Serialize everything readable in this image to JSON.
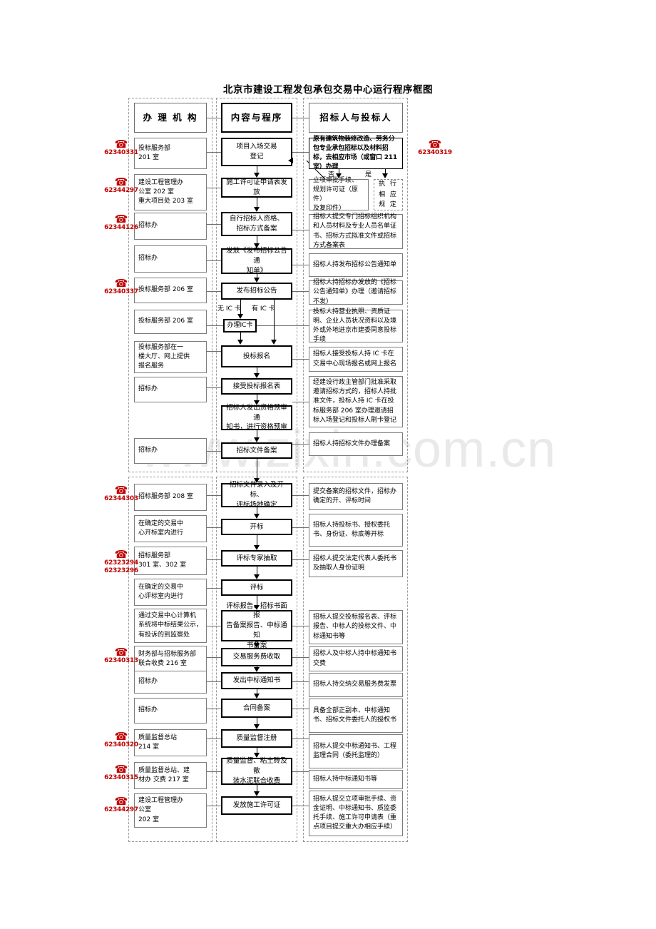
{
  "title": "北京市建设工程发包承包交易中心运行程序框图",
  "watermark": "www.zixin.com.cn",
  "headers": {
    "left": "办 理 机 构",
    "center": "内容与程序",
    "right": "招标人与投标人"
  },
  "branch_labels": {
    "no": "否",
    "yes": "是",
    "no_ic": "无 IC 卡",
    "has_ic": "有 IC 卡"
  },
  "left_column": [
    {
      "text": "投标服务部\n201 室"
    },
    {
      "text": "建设工程管理办\n公室 202 室\n重大项目处 203 室"
    },
    {
      "text": "招标办"
    },
    {
      "text": "招标办"
    },
    {
      "text": "投标服务部 206 室"
    },
    {
      "text": "投标服务部 206 室"
    },
    {
      "text": "投标服务部在一\n楼大厅、网上提供\n报名服务"
    },
    {
      "text": "招标办"
    },
    {
      "text": "招标办"
    },
    {
      "text": "招标服务部 208 室"
    },
    {
      "text": "在确定的交易中\n心开标室内进行"
    },
    {
      "text": "招标服务部\n301 室、302 室"
    },
    {
      "text": "在确定的交易中\n心评标室内进行"
    },
    {
      "text": "通过交易中心计算机\n系统将中标结果公示，\n有投诉的到监察处"
    },
    {
      "text": "财务部与招标服务部\n联合收费 216 室"
    },
    {
      "text": "招标办"
    },
    {
      "text": "招标办"
    },
    {
      "text": "质量监督总站\n214 室"
    },
    {
      "text": "质量监督总站、建\n材办 交费 217 室"
    },
    {
      "text": "建设工程管理办\n公室\n202 室"
    }
  ],
  "center_column": [
    {
      "text": "项目入场交易\n登记"
    },
    {
      "text": "施工许可证申请表发放"
    },
    {
      "text": "自行招标人资格、\n招标方式备案"
    },
    {
      "text": "发放《发布招标公告通\n知单》"
    },
    {
      "text": "发布招标公告"
    },
    {
      "text": "办理IC卡"
    },
    {
      "text": "投标报名"
    },
    {
      "text": "接受投标报名表"
    },
    {
      "text": "招标人发出资格预审通\n知书，进行资格预审"
    },
    {
      "text": "招标文件备案"
    },
    {
      "text": "招标文件录入及开标、\n评标场地确定"
    },
    {
      "text": "开标"
    },
    {
      "text": "评标专家抽取"
    },
    {
      "text": "评标"
    },
    {
      "text": "评标报告、招标书面报\n告备案报告、中标通知\n书备案"
    },
    {
      "text": "交易服务费收取"
    },
    {
      "text": "发出中标通知书"
    },
    {
      "text": "合同备案"
    },
    {
      "text": "质量监督注册"
    },
    {
      "text": "质量监督、粘土砖及散\n装水泥联合收费"
    },
    {
      "text": "发放施工许可证"
    }
  ],
  "right_column": [
    {
      "text": "原有建筑物装修改造、劳务分包专业承包招标以及材料招标，去相应市场（或窗口 211 室）办理"
    },
    {
      "text": "立项审批手续、\n规划许可证（原件）\n及复印件）"
    },
    {
      "text": "执 行\n相 应\n规 定"
    },
    {
      "text": "招标人提交专门招标组织机构和人员材料及专业人员名单证书、招标方式拟准文件或招标方式备案表"
    },
    {
      "text": "招标人持发布招标公告通知单"
    },
    {
      "text": "招标人持招标办发放的《招标公告通知单》办理（邀请招标不发）"
    },
    {
      "text": "投标人持营业执照、资质证明、企业人员状况资料以及境外或外地进京市建委同意投标手续"
    },
    {
      "text": "招标人接受投标人持 IC 卡在交易中心现场报名或网上报名"
    },
    {
      "text": "经建设行政主管部门批准采取邀请招标方式的，招标人持批准文件，投标人持 IC 卡在投标服务部 206 室办理邀请招标入场登记和投标人刷卡登记"
    },
    {
      "text": "招标人持招标文件办理备案"
    },
    {
      "text": "提交备案的招标文件，招标办确定的开、评标时间"
    },
    {
      "text": "招标人持投标书、授权委托书、身份证、标底等开标"
    },
    {
      "text": "招标人提交法定代表人委托书及抽取人身份证明"
    },
    {
      "text": "招标人提交投标报名表、评标报告、中标人的投标文件、中标通知书等"
    },
    {
      "text": "招标人及中标人持中标通知书交费"
    },
    {
      "text": "招标人持交纳交易服务费发票"
    },
    {
      "text": "具备全部正副本、中标通知书、招标文件委托人的授权书"
    },
    {
      "text": "招标人提交中标通知书、工程监理合同（委托监理的）"
    },
    {
      "text": "招标人持中标通知书等"
    },
    {
      "text": "招标人提交立项审批手续、资金证明、中标通知书、质监委托手续、施工许可申请表（重点项目提交重大办相应手续）"
    }
  ],
  "phones_left": [
    {
      "number": "62340331",
      "icon": "telephone-icon"
    },
    {
      "number": "62344297",
      "icon": "telephone-icon"
    },
    {
      "number": "62344126",
      "icon": "telephone-icon"
    },
    {
      "number": "62340337",
      "icon": "telephone-icon"
    },
    {
      "number": "62344303",
      "icon": "telephone-icon"
    },
    {
      "number": "62323294",
      "number2": "62323296",
      "icon": "telephone-icon"
    },
    {
      "number": "62340313",
      "icon": "telephone-icon"
    },
    {
      "number": "62340320",
      "icon": "telephone-icon"
    },
    {
      "number": "62340315",
      "icon": "telephone-icon"
    },
    {
      "number": "62344297",
      "icon": "telephone-icon"
    }
  ],
  "phones_right": [
    {
      "number": "62340319",
      "icon": "telephone-icon"
    }
  ],
  "colors": {
    "phone_red": "#c00000",
    "box_border": "#7d7d7d",
    "heavy_border": "#000000",
    "group_border": "#9a9a9a",
    "watermark": "#e9e9ea"
  }
}
